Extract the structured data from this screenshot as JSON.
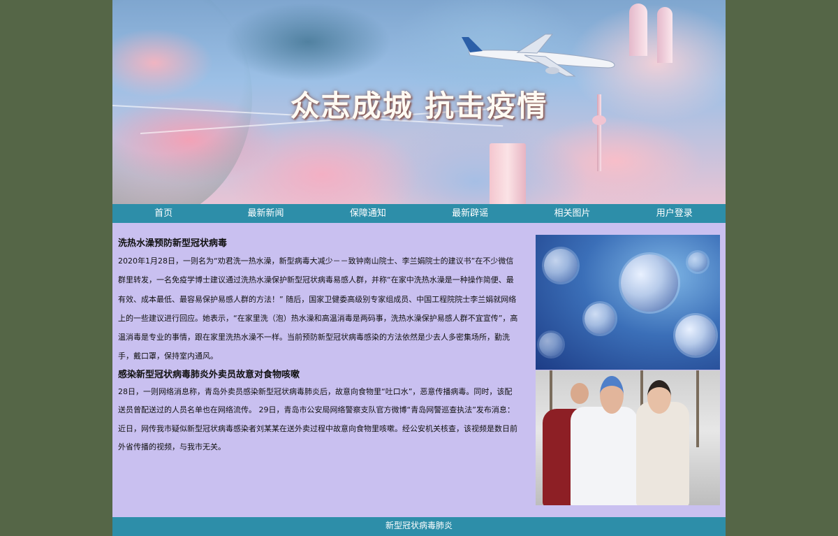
{
  "banner": {
    "title": "众志成城 抗击疫情"
  },
  "nav": {
    "items": [
      {
        "label": "首页"
      },
      {
        "label": "最新新闻"
      },
      {
        "label": "保障通知"
      },
      {
        "label": "最新辟谣"
      },
      {
        "label": "相关图片"
      },
      {
        "label": "用户登录"
      }
    ]
  },
  "articles": [
    {
      "title": "洗热水澡预防新型冠状病毒",
      "body": "2020年1月28日，一则名为“劝君洗一热水澡，新型病毒大减少－－致钟南山院士、李兰娟院士的建议书”在不少微信群里转发，一名免疫学博士建议通过洗热水澡保护新型冠状病毒易感人群，并称“在家中洗热水澡是一种操作简便、最有效、成本最低、最容易保护易感人群的方法！” 随后，国家卫健委高级别专家组成员、中国工程院院士李兰娟就网络上的一些建议进行回应。她表示，“在家里洗（泡）热水澡和高温消毒是两码事，洗热水澡保护易感人群不宜宣传”，高温消毒是专业的事情，跟在家里洗热水澡不一样。当前预防新型冠状病毒感染的方法依然是少去人多密集场所，勤洗手，戴口罩，保持室内通风。"
    },
    {
      "title": "感染新型冠状病毒肺炎外卖员故意对食物咳嗽",
      "body": "28日，一则网络消息称，青岛外卖员感染新型冠状病毒肺炎后，故意向食物里“吐口水”，恶意传播病毒。同时，该配送员曾配送过的人员名单也在网络流传。 29日，青岛市公安局网络警察支队官方微博“青岛网警巡查执法”发布消息：近日，网传我市疑似新型冠状病毒感染者刘某某在送外卖过程中故意向食物里咳嗽。经公安机关核查，该视频是数日前外省传播的视频，与我市无关。"
    }
  ],
  "footer": {
    "text": "新型冠状病毒肺炎"
  },
  "colors": {
    "page_bg": "#556647",
    "content_bg": "#c9c0f0",
    "nav_bg": "#2d8ea9"
  }
}
